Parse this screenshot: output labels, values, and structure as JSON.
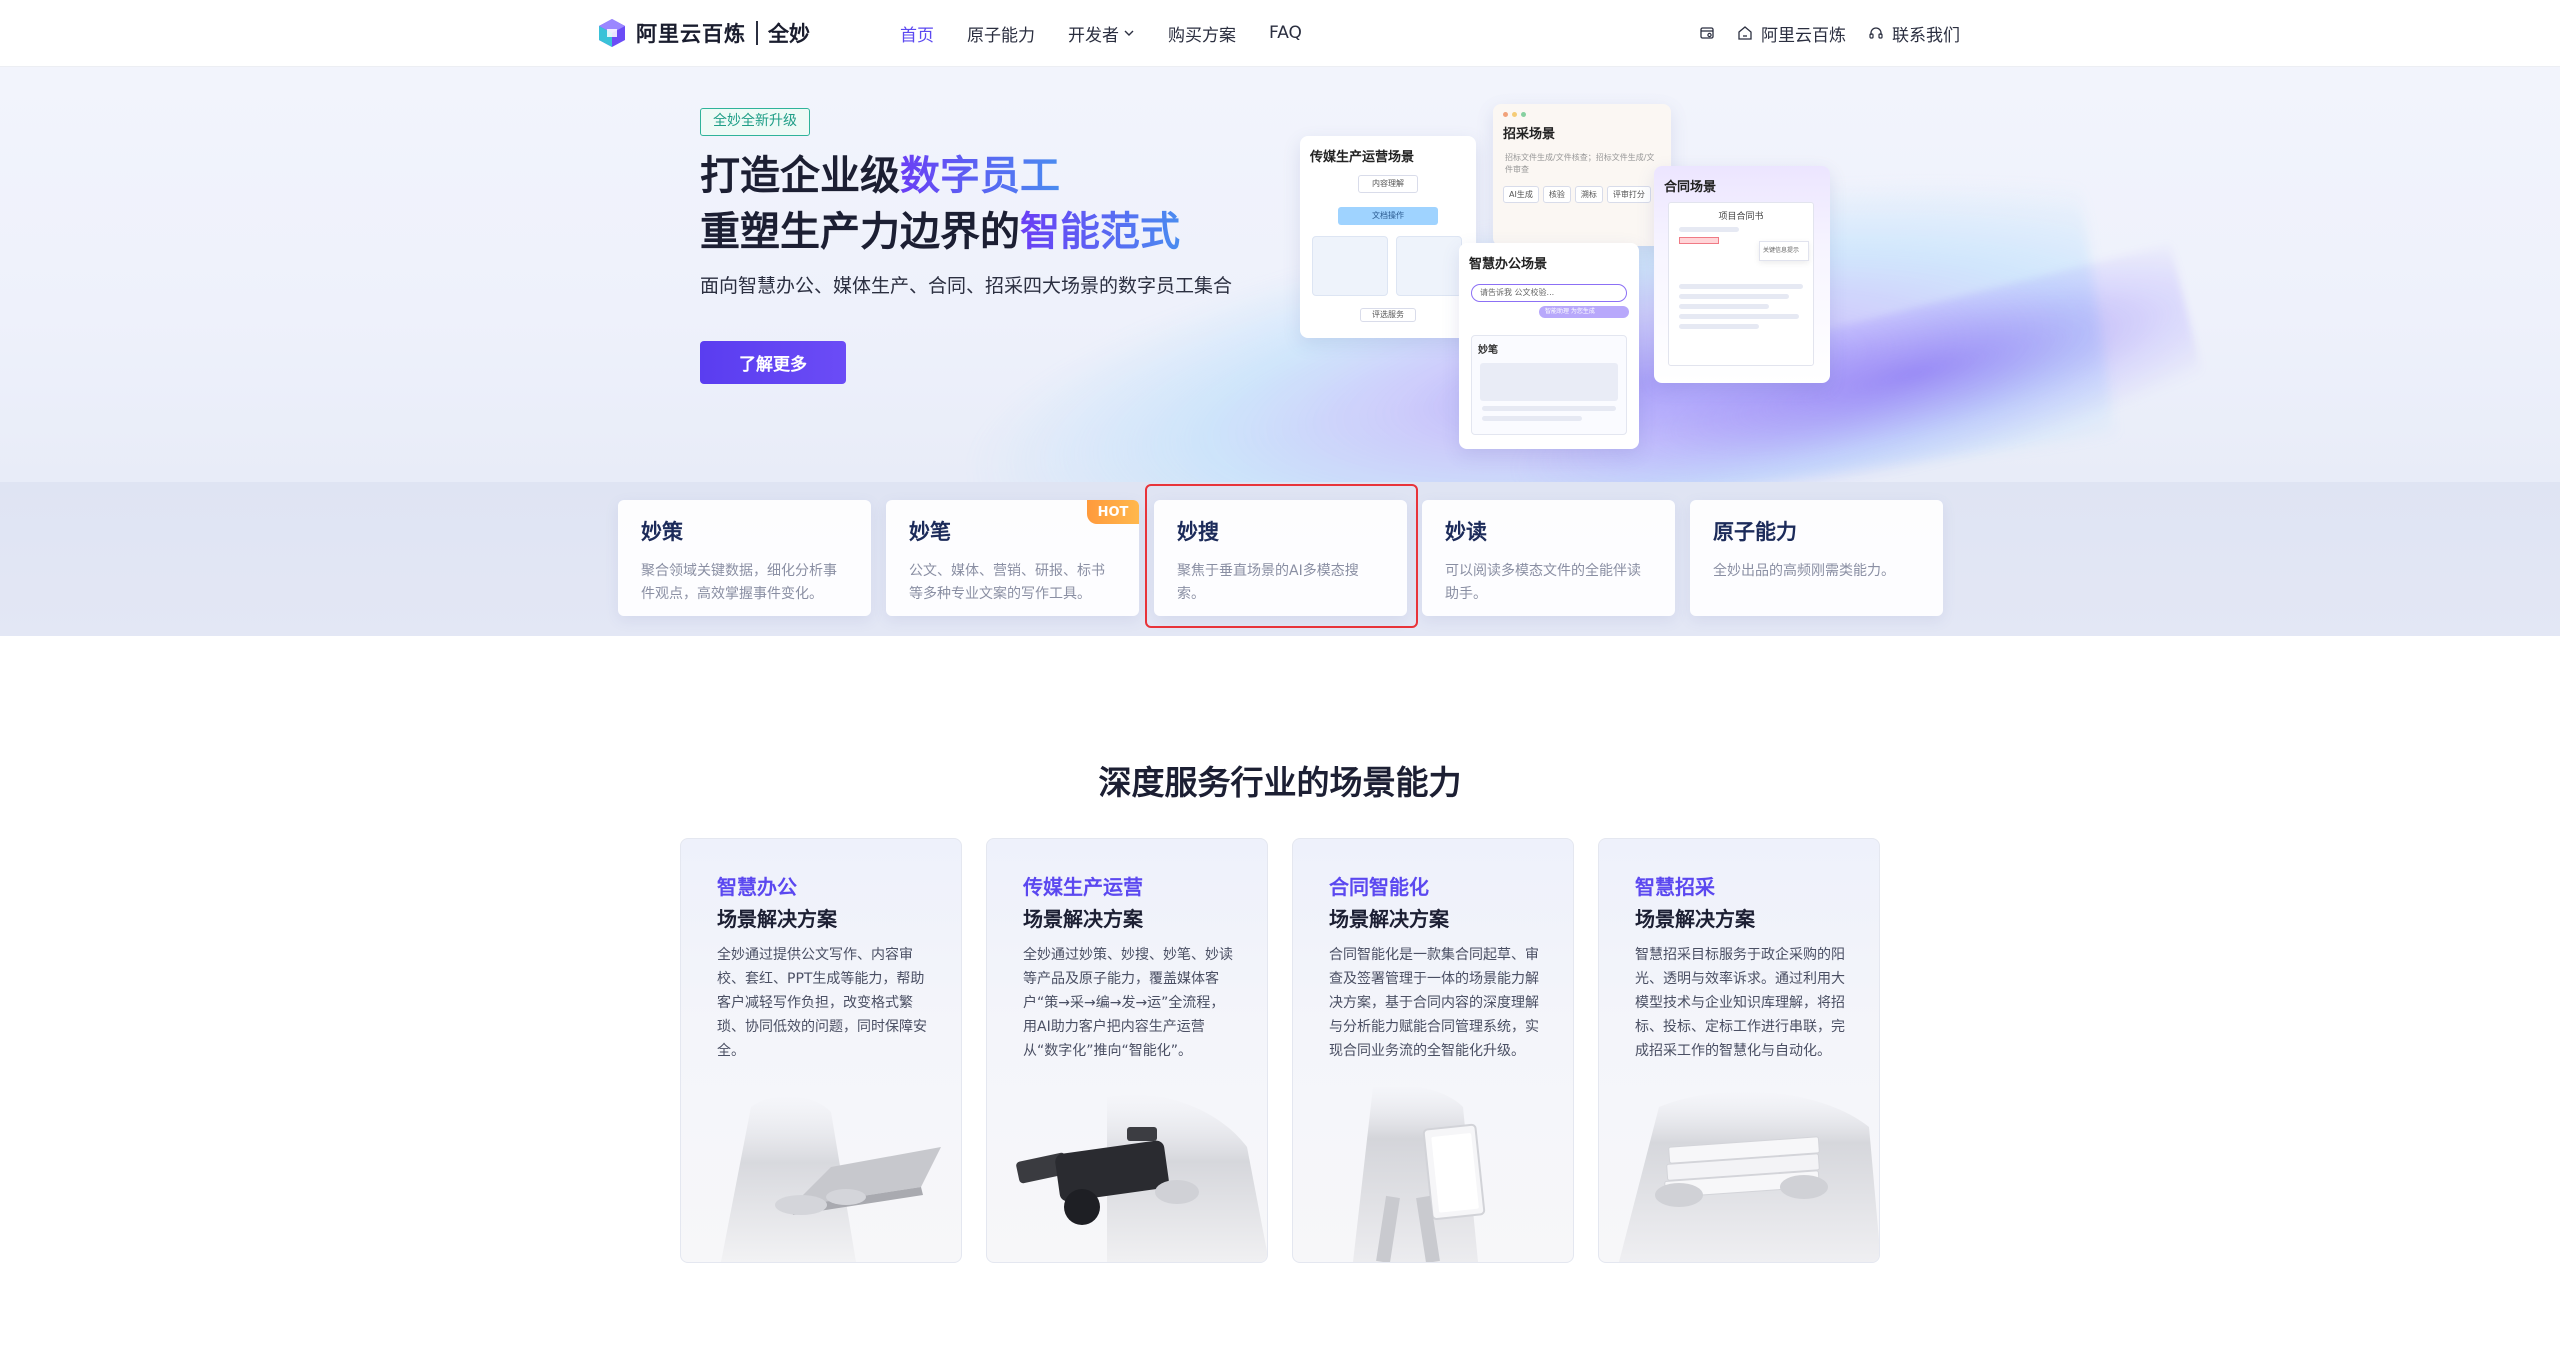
{
  "nav": {
    "brand": "阿里云百炼",
    "product": "全妙",
    "links": [
      {
        "label": "首页",
        "active": true
      },
      {
        "label": "原子能力",
        "active": false
      },
      {
        "label": "开发者",
        "active": false,
        "has_dropdown": true
      },
      {
        "label": "购买方案",
        "active": false
      },
      {
        "label": "FAQ",
        "active": false
      }
    ],
    "right": {
      "home_label": "阿里云百炼",
      "contact_label": "联系我们"
    },
    "accent_color": "#5b48f0"
  },
  "hero": {
    "badge": "全妙全新升级",
    "line1_prefix": "打造企业级",
    "line1_highlight": "数字员工",
    "line2_prefix": "重塑生产力边界的",
    "line2_highlight": "智能范式",
    "subtitle": "面向智慧办公、媒体生产、合同、招采四大场景的数字员工集合",
    "cta": "了解更多",
    "mock_cards": {
      "media": {
        "title": "传媒生产运营场景",
        "chips": [
          "内容理解",
          "文档操作",
          "评选服务"
        ]
      },
      "bidding": {
        "title": "招采场景",
        "desc": "招标文件生成/文件核查；招标文件生成/文件审查",
        "tags": [
          "AI生成",
          "核验",
          "溯标",
          "评审打分",
          "标注"
        ]
      },
      "office": {
        "title": "智慧办公场景",
        "input": "请告诉我 公文校验...",
        "reply": "智能助理 为您生成 ",
        "sub": "妙笔"
      },
      "contract": {
        "title": "合同场景",
        "doc_title": "项目合同书",
        "mark": "关键信息提示"
      }
    }
  },
  "products": [
    {
      "title": "妙策",
      "desc": "聚合领域关键数据，细化分析事件观点，高效掌握事件变化。",
      "hot": false
    },
    {
      "title": "妙笔",
      "desc": "公文、媒体、营销、研报、标书等多种专业文案的写作工具。",
      "hot": true,
      "hot_label": "HOT"
    },
    {
      "title": "妙搜",
      "desc": "聚焦于垂直场景的AI多模态搜索。",
      "hot": false,
      "highlighted": true
    },
    {
      "title": "妙读",
      "desc": "可以阅读多模态文件的全能伴读助手。",
      "hot": false
    },
    {
      "title": "原子能力",
      "desc": "全妙出品的高频刚需类能力。",
      "hot": false
    }
  ],
  "scenarios": {
    "title": "深度服务行业的场景能力",
    "cards": [
      {
        "name": "智慧办公",
        "subtitle": "场景解决方案",
        "desc": "全妙通过提供公文写作、内容审校、套红、PPT生成等能力，帮助客户减轻写作负担，改变格式繁琐、协同低效的问题，同时保障安全。",
        "image": "laptop-typing"
      },
      {
        "name": "传媒生产运营",
        "subtitle": "场景解决方案",
        "desc": "全妙通过妙策、妙搜、妙笔、妙读等产品及原子能力，覆盖媒体客户“策→采→编→发→运”全流程，用AI助力客户把内容生产运营从“数字化”推向“智能化”。",
        "image": "video-camera"
      },
      {
        "name": "合同智能化",
        "subtitle": "场景解决方案",
        "desc": "合同智能化是一款集合同起草、审查及签署管理于一体的场景能力解决方案，基于合同内容的深度理解与分析能力赋能合同管理系统，实现合同业务流的全智能化升级。",
        "image": "folder-holding"
      },
      {
        "name": "智慧招采",
        "subtitle": "场景解决方案",
        "desc": "智慧招采目标服务于政企采购的阳光、透明与效率诉求。通过利用大模型技术与企业知识库理解，将招标、投标、定标工作进行串联，完成招采工作的智慧化与自动化。",
        "image": "paper-stack"
      }
    ]
  }
}
